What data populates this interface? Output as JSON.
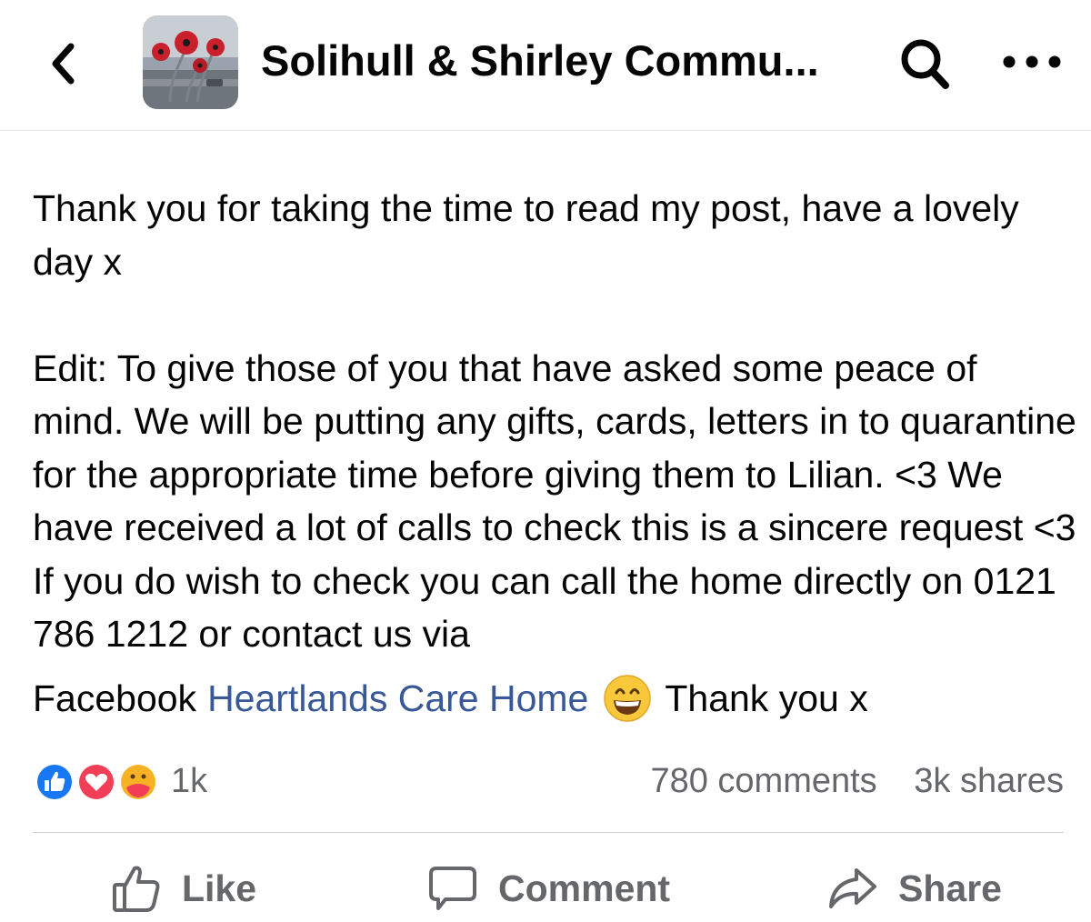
{
  "header": {
    "group_name": "Solihull & Shirley Commu...",
    "back_icon": "chevron-left-icon",
    "search_icon": "search-icon",
    "more_icon": "more-horizontal-icon"
  },
  "post": {
    "paragraph1": "Thank you for taking the time to read my post, have a lovely day x",
    "paragraph2": "Edit: To give those of you that have asked some peace of mind. We will be putting any gifts, cards, letters in to quarantine for the appropriate time before giving them to Lilian. <3 We have received a lot of calls to check this is a sincere request <3 If you do wish to check you can call the home directly on 0121 786 1212 or contact us via",
    "last_line_prefix": "Facebook",
    "link_text": "Heartlands Care Home",
    "emoji": "grinning-face-emoji",
    "last_line_suffix": "Thank you x"
  },
  "stats": {
    "reactions": [
      "like",
      "love",
      "care"
    ],
    "reaction_count": "1k",
    "comments": "780 comments",
    "shares": "3k shares"
  },
  "actions": {
    "like": "Like",
    "comment": "Comment",
    "share": "Share"
  },
  "colors": {
    "link": "#385898",
    "secondary_text": "#65676b",
    "like_blue": "#1877f2",
    "love_red": "#f33e58",
    "care_yellow": "#f7b125"
  }
}
